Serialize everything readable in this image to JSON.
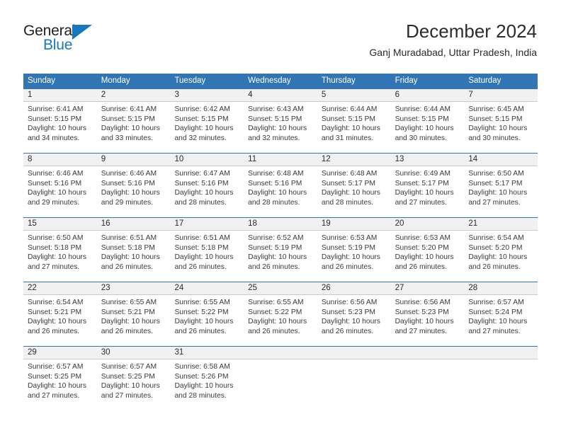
{
  "brand": {
    "name_part1": "General",
    "name_part2": "Blue",
    "triangle_icon": "blue-triangle-logo-mark",
    "accent_color": "#1878be"
  },
  "header": {
    "title": "December 2024",
    "subtitle": "Ganj Muradabad, Uttar Pradesh, India"
  },
  "theme": {
    "header_blue": "#3275b4",
    "day_band_gray": "#f1f1f1",
    "border_gray": "#c9c9c9",
    "text_color": "#2b2b2b"
  },
  "weekdays": [
    "Sunday",
    "Monday",
    "Tuesday",
    "Wednesday",
    "Thursday",
    "Friday",
    "Saturday"
  ],
  "labels": {
    "sunrise_prefix": "Sunrise:",
    "sunset_prefix": "Sunset:",
    "daylight_prefix": "Daylight:"
  },
  "weeks": [
    {
      "days": [
        {
          "num": "1",
          "l1": "Sunrise: 6:41 AM",
          "l2": "Sunset: 5:15 PM",
          "l3": "Daylight: 10 hours",
          "l4": "and 34 minutes."
        },
        {
          "num": "2",
          "l1": "Sunrise: 6:41 AM",
          "l2": "Sunset: 5:15 PM",
          "l3": "Daylight: 10 hours",
          "l4": "and 33 minutes."
        },
        {
          "num": "3",
          "l1": "Sunrise: 6:42 AM",
          "l2": "Sunset: 5:15 PM",
          "l3": "Daylight: 10 hours",
          "l4": "and 32 minutes."
        },
        {
          "num": "4",
          "l1": "Sunrise: 6:43 AM",
          "l2": "Sunset: 5:15 PM",
          "l3": "Daylight: 10 hours",
          "l4": "and 32 minutes."
        },
        {
          "num": "5",
          "l1": "Sunrise: 6:44 AM",
          "l2": "Sunset: 5:15 PM",
          "l3": "Daylight: 10 hours",
          "l4": "and 31 minutes."
        },
        {
          "num": "6",
          "l1": "Sunrise: 6:44 AM",
          "l2": "Sunset: 5:15 PM",
          "l3": "Daylight: 10 hours",
          "l4": "and 30 minutes."
        },
        {
          "num": "7",
          "l1": "Sunrise: 6:45 AM",
          "l2": "Sunset: 5:15 PM",
          "l3": "Daylight: 10 hours",
          "l4": "and 30 minutes."
        }
      ]
    },
    {
      "days": [
        {
          "num": "8",
          "l1": "Sunrise: 6:46 AM",
          "l2": "Sunset: 5:16 PM",
          "l3": "Daylight: 10 hours",
          "l4": "and 29 minutes."
        },
        {
          "num": "9",
          "l1": "Sunrise: 6:46 AM",
          "l2": "Sunset: 5:16 PM",
          "l3": "Daylight: 10 hours",
          "l4": "and 29 minutes."
        },
        {
          "num": "10",
          "l1": "Sunrise: 6:47 AM",
          "l2": "Sunset: 5:16 PM",
          "l3": "Daylight: 10 hours",
          "l4": "and 28 minutes."
        },
        {
          "num": "11",
          "l1": "Sunrise: 6:48 AM",
          "l2": "Sunset: 5:16 PM",
          "l3": "Daylight: 10 hours",
          "l4": "and 28 minutes."
        },
        {
          "num": "12",
          "l1": "Sunrise: 6:48 AM",
          "l2": "Sunset: 5:17 PM",
          "l3": "Daylight: 10 hours",
          "l4": "and 28 minutes."
        },
        {
          "num": "13",
          "l1": "Sunrise: 6:49 AM",
          "l2": "Sunset: 5:17 PM",
          "l3": "Daylight: 10 hours",
          "l4": "and 27 minutes."
        },
        {
          "num": "14",
          "l1": "Sunrise: 6:50 AM",
          "l2": "Sunset: 5:17 PM",
          "l3": "Daylight: 10 hours",
          "l4": "and 27 minutes."
        }
      ]
    },
    {
      "days": [
        {
          "num": "15",
          "l1": "Sunrise: 6:50 AM",
          "l2": "Sunset: 5:18 PM",
          "l3": "Daylight: 10 hours",
          "l4": "and 27 minutes."
        },
        {
          "num": "16",
          "l1": "Sunrise: 6:51 AM",
          "l2": "Sunset: 5:18 PM",
          "l3": "Daylight: 10 hours",
          "l4": "and 26 minutes."
        },
        {
          "num": "17",
          "l1": "Sunrise: 6:51 AM",
          "l2": "Sunset: 5:18 PM",
          "l3": "Daylight: 10 hours",
          "l4": "and 26 minutes."
        },
        {
          "num": "18",
          "l1": "Sunrise: 6:52 AM",
          "l2": "Sunset: 5:19 PM",
          "l3": "Daylight: 10 hours",
          "l4": "and 26 minutes."
        },
        {
          "num": "19",
          "l1": "Sunrise: 6:53 AM",
          "l2": "Sunset: 5:19 PM",
          "l3": "Daylight: 10 hours",
          "l4": "and 26 minutes."
        },
        {
          "num": "20",
          "l1": "Sunrise: 6:53 AM",
          "l2": "Sunset: 5:20 PM",
          "l3": "Daylight: 10 hours",
          "l4": "and 26 minutes."
        },
        {
          "num": "21",
          "l1": "Sunrise: 6:54 AM",
          "l2": "Sunset: 5:20 PM",
          "l3": "Daylight: 10 hours",
          "l4": "and 26 minutes."
        }
      ]
    },
    {
      "days": [
        {
          "num": "22",
          "l1": "Sunrise: 6:54 AM",
          "l2": "Sunset: 5:21 PM",
          "l3": "Daylight: 10 hours",
          "l4": "and 26 minutes."
        },
        {
          "num": "23",
          "l1": "Sunrise: 6:55 AM",
          "l2": "Sunset: 5:21 PM",
          "l3": "Daylight: 10 hours",
          "l4": "and 26 minutes."
        },
        {
          "num": "24",
          "l1": "Sunrise: 6:55 AM",
          "l2": "Sunset: 5:22 PM",
          "l3": "Daylight: 10 hours",
          "l4": "and 26 minutes."
        },
        {
          "num": "25",
          "l1": "Sunrise: 6:55 AM",
          "l2": "Sunset: 5:22 PM",
          "l3": "Daylight: 10 hours",
          "l4": "and 26 minutes."
        },
        {
          "num": "26",
          "l1": "Sunrise: 6:56 AM",
          "l2": "Sunset: 5:23 PM",
          "l3": "Daylight: 10 hours",
          "l4": "and 26 minutes."
        },
        {
          "num": "27",
          "l1": "Sunrise: 6:56 AM",
          "l2": "Sunset: 5:23 PM",
          "l3": "Daylight: 10 hours",
          "l4": "and 27 minutes."
        },
        {
          "num": "28",
          "l1": "Sunrise: 6:57 AM",
          "l2": "Sunset: 5:24 PM",
          "l3": "Daylight: 10 hours",
          "l4": "and 27 minutes."
        }
      ]
    },
    {
      "days": [
        {
          "num": "29",
          "l1": "Sunrise: 6:57 AM",
          "l2": "Sunset: 5:25 PM",
          "l3": "Daylight: 10 hours",
          "l4": "and 27 minutes."
        },
        {
          "num": "30",
          "l1": "Sunrise: 6:57 AM",
          "l2": "Sunset: 5:25 PM",
          "l3": "Daylight: 10 hours",
          "l4": "and 27 minutes."
        },
        {
          "num": "31",
          "l1": "Sunrise: 6:58 AM",
          "l2": "Sunset: 5:26 PM",
          "l3": "Daylight: 10 hours",
          "l4": "and 28 minutes."
        },
        {
          "num": "",
          "l1": "",
          "l2": "",
          "l3": "",
          "l4": ""
        },
        {
          "num": "",
          "l1": "",
          "l2": "",
          "l3": "",
          "l4": ""
        },
        {
          "num": "",
          "l1": "",
          "l2": "",
          "l3": "",
          "l4": ""
        },
        {
          "num": "",
          "l1": "",
          "l2": "",
          "l3": "",
          "l4": ""
        }
      ]
    }
  ]
}
